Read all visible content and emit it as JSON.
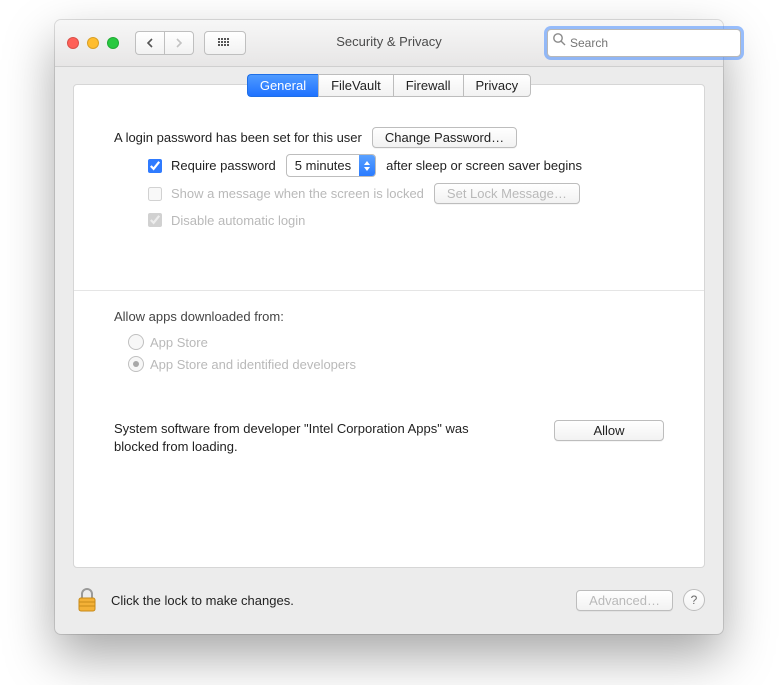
{
  "window": {
    "title": "Security & Privacy"
  },
  "toolbar": {
    "search_placeholder": "Search"
  },
  "tabs": [
    {
      "label": "General",
      "active": true
    },
    {
      "label": "FileVault",
      "active": false
    },
    {
      "label": "Firewall",
      "active": false
    },
    {
      "label": "Privacy",
      "active": false
    }
  ],
  "general": {
    "password_set_text": "A login password has been set for this user",
    "change_password_label": "Change Password…",
    "require_password_label": "Require password",
    "require_password_checked": true,
    "delay_selected": "5 minutes",
    "after_sleep_text": "after sleep or screen saver begins",
    "show_message_label": "Show a message when the screen is locked",
    "show_message_checked": false,
    "set_lock_message_label": "Set Lock Message…",
    "disable_auto_login_label": "Disable automatic login",
    "disable_auto_login_checked": true
  },
  "allow_apps": {
    "heading": "Allow apps downloaded from:",
    "options": [
      {
        "label": "App Store",
        "selected": false
      },
      {
        "label": "App Store and identified developers",
        "selected": true
      }
    ]
  },
  "blocked_software": {
    "message": "System software from developer \"Intel Corporation Apps\" was blocked from loading.",
    "allow_label": "Allow"
  },
  "footer": {
    "lock_text": "Click the lock to make changes.",
    "advanced_label": "Advanced…"
  }
}
